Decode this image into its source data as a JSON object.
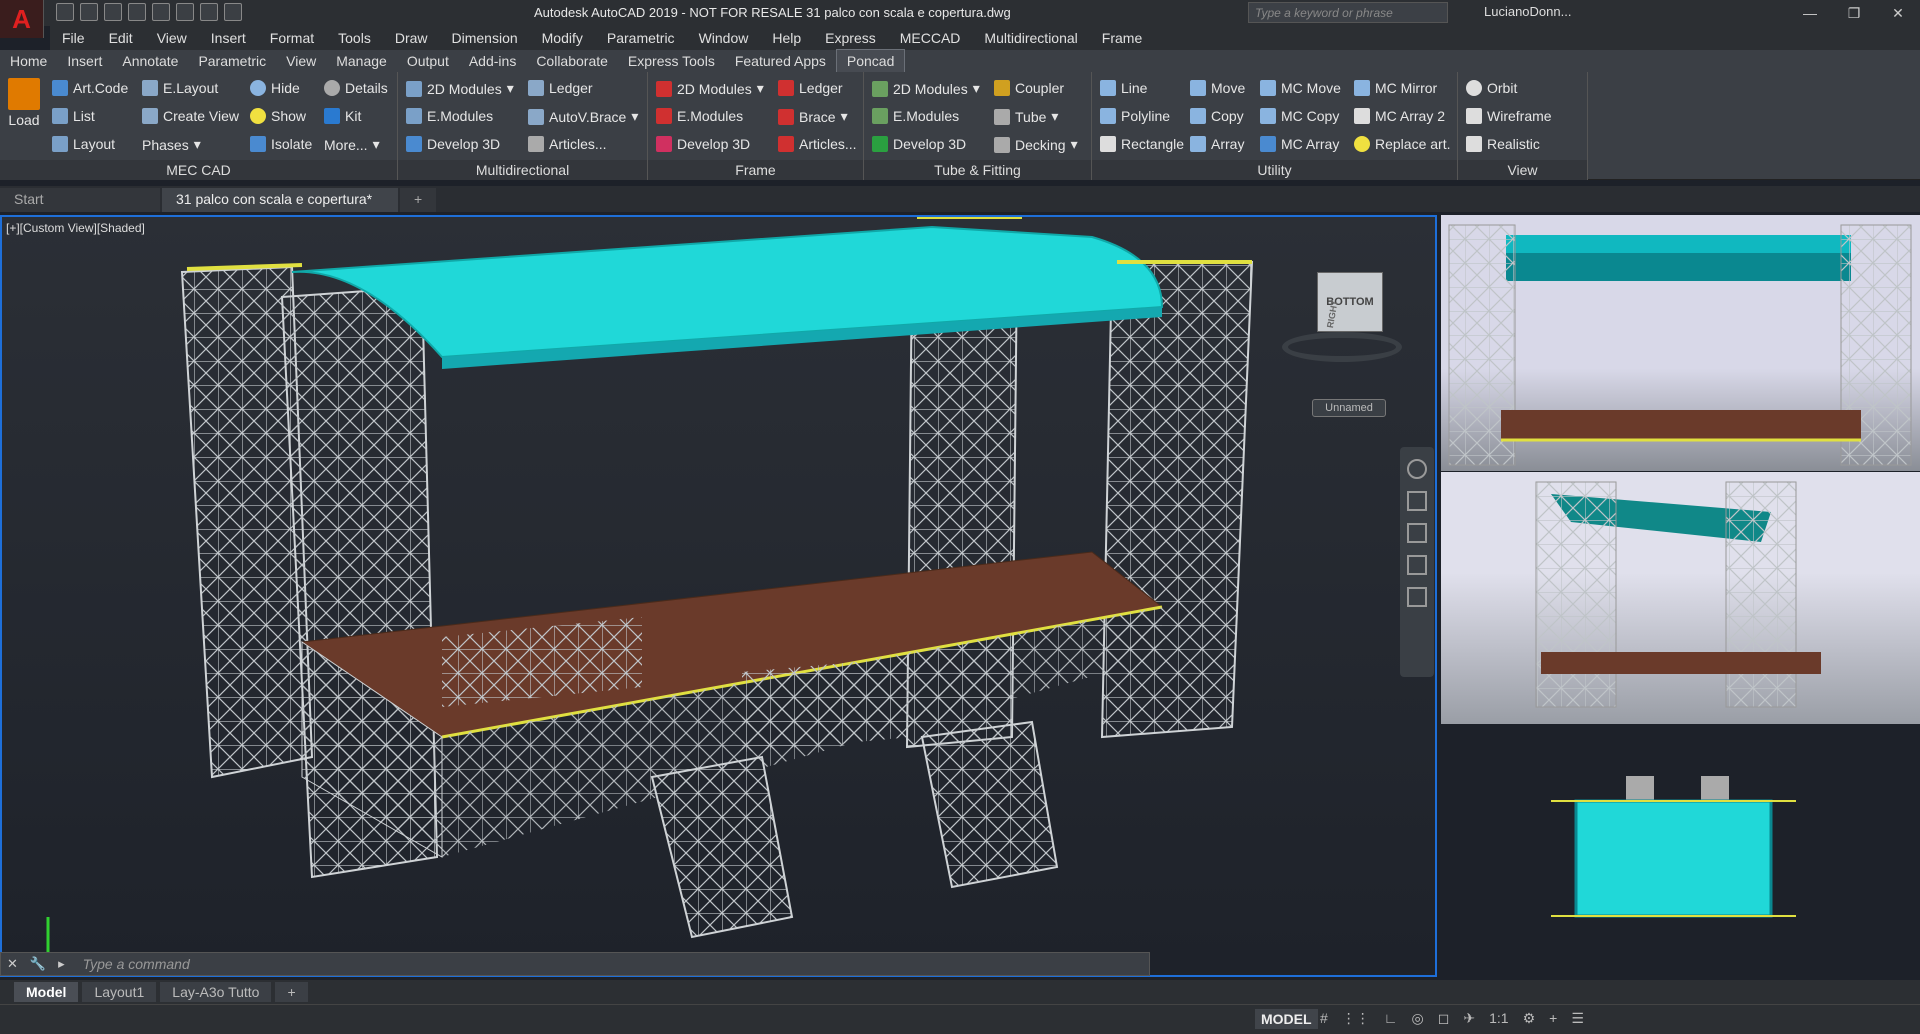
{
  "app": {
    "logo": "A",
    "title": "Autodesk AutoCAD 2019 - NOT FOR RESALE    31 palco con scala e copertura.dwg",
    "search_placeholder": "Type a keyword or phrase",
    "user": "LucianoDonn..."
  },
  "menu": [
    "File",
    "Edit",
    "View",
    "Insert",
    "Format",
    "Tools",
    "Draw",
    "Dimension",
    "Modify",
    "Parametric",
    "Window",
    "Help",
    "Express",
    "MECCAD",
    "Multidirectional",
    "Frame"
  ],
  "ribbon_tabs": [
    "Home",
    "Insert",
    "Annotate",
    "Parametric",
    "View",
    "Manage",
    "Output",
    "Add-ins",
    "Collaborate",
    "Express Tools",
    "Featured Apps",
    "Poncad"
  ],
  "ribbon_active": "Poncad",
  "panels": {
    "mec_cad": {
      "title": "MEC CAD",
      "load": "Load",
      "items": [
        "Art.Code",
        "List",
        "Layout",
        "E.Layout",
        "Create View",
        "Phases",
        "Hide",
        "Show",
        "Isolate",
        "Details",
        "Kit",
        "More..."
      ]
    },
    "multidirectional": {
      "title": "Multidirectional",
      "items": [
        "2D Modules",
        "E.Modules",
        "Develop 3D",
        "Ledger",
        "AutoV.Brace",
        "Articles..."
      ]
    },
    "frame": {
      "title": "Frame",
      "items": [
        "2D Modules",
        "E.Modules",
        "Develop 3D",
        "Ledger",
        "Brace",
        "Articles..."
      ]
    },
    "tube": {
      "title": "Tube & Fitting",
      "items": [
        "2D Modules",
        "E.Modules",
        "Develop 3D",
        "Coupler",
        "Tube",
        "Decking"
      ]
    },
    "utility": {
      "title": "Utility",
      "items": [
        "Line",
        "Polyline",
        "Rectangle",
        "Move",
        "Copy",
        "Array",
        "MC Move",
        "MC Copy",
        "MC Array",
        "MC Mirror",
        "MC Array 2",
        "Replace art."
      ]
    },
    "view": {
      "title": "View",
      "items": [
        "Orbit",
        "Wireframe",
        "Realistic"
      ]
    }
  },
  "doc_tabs": [
    "Start",
    "31 palco con scala e copertura*"
  ],
  "viewport": {
    "label": "[+][Custom View][Shaded]",
    "viewcube": "BOTTOM",
    "viewcube_side": "RIGHT",
    "named": "Unnamed"
  },
  "command": {
    "placeholder": "Type a command"
  },
  "layouts": [
    "Model",
    "Layout1",
    "Lay-A3o Tutto"
  ],
  "status": {
    "model": "MODEL",
    "scale": "1:1"
  },
  "colors": {
    "accent": "#1e6fd9",
    "canopy": "#20d8d8",
    "deck": "#6a3a2a"
  }
}
